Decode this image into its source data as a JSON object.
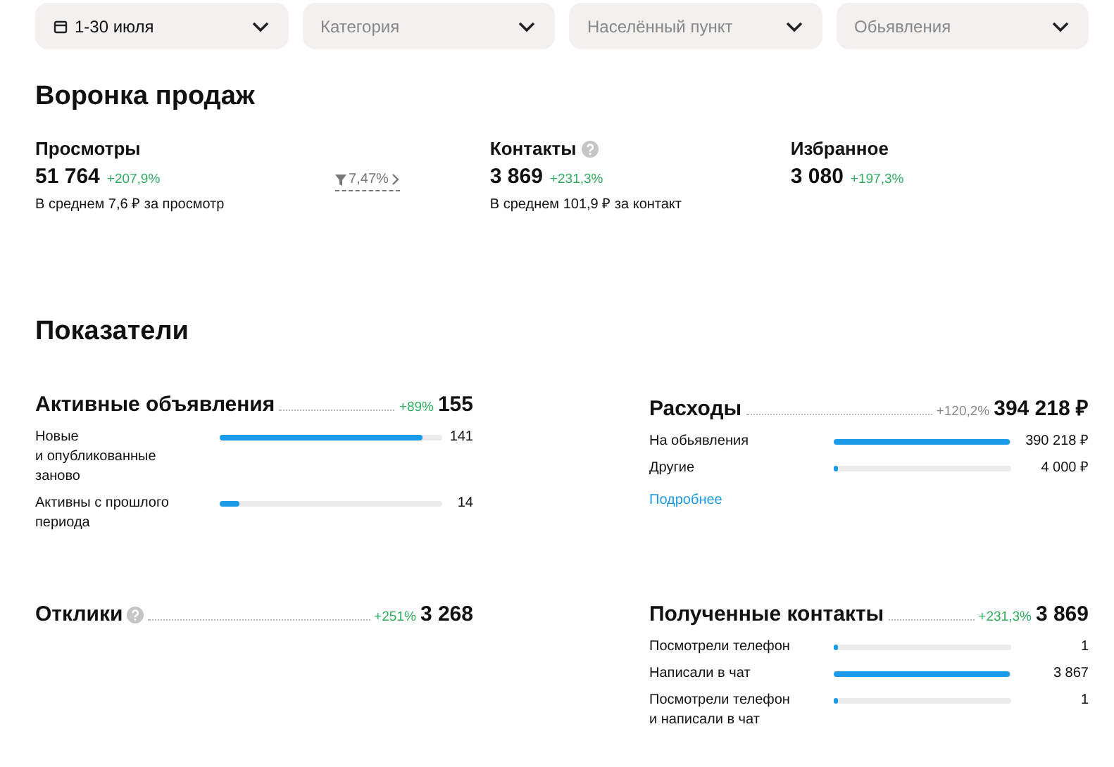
{
  "filters": [
    {
      "kind": "date",
      "label": "1-30 июля",
      "placeholder": false
    },
    {
      "kind": "select",
      "label": "Категория",
      "placeholder": true
    },
    {
      "kind": "select",
      "label": "Населённый пункт",
      "placeholder": true
    },
    {
      "kind": "select",
      "label": "Обьявления",
      "placeholder": true
    }
  ],
  "funnel": {
    "title": "Воронка продаж",
    "stages": [
      {
        "title": "Просмотры",
        "value": "51 764",
        "change": "+207,9%",
        "note": "В среднем 7,6 ₽ за просмотр",
        "conversion": "7,47%"
      },
      {
        "title": "Контакты",
        "help": true,
        "value": "3 869",
        "change": "+231,3%",
        "note": "В среднем 101,9 ₽ за контакт"
      },
      {
        "title": "Избранное",
        "value": "3 080",
        "change": "+197,3%"
      }
    ]
  },
  "indicators": {
    "title": "Показатели",
    "cards": [
      {
        "title": "Активные объявления",
        "change": "+89%",
        "color": "#2fae5f",
        "total": "155",
        "rows": [
          {
            "label": "Новые\nи опубликованные\nзаново",
            "level": 0.91,
            "value": "141"
          },
          {
            "label": "Активны с прошлого\nпериода",
            "level": 0.09,
            "value": "14"
          }
        ]
      },
      {
        "title": "Расходы",
        "change": "+120,2%",
        "color": "#8a8a8a",
        "total": "394 218 ₽",
        "rows": [
          {
            "label": "На обьявления",
            "level": 0.99,
            "value": "390 218 ₽"
          },
          {
            "label": "Другие",
            "level": 0.01,
            "value": "4 000 ₽"
          }
        ],
        "link": "Подробнее"
      },
      {
        "title": "Отклики",
        "help": true,
        "change": "+251%",
        "color": "#2fae5f",
        "total": "3 268"
      },
      {
        "title": "Полученные контакты",
        "change": "+231,3%",
        "color": "#2fae5f",
        "total": "3 869",
        "rows": [
          {
            "label": "Посмотрели телефон",
            "level": 0.01,
            "value": "1"
          },
          {
            "label": "Написали в чат",
            "level": 0.99,
            "value": "3 867"
          },
          {
            "label": "Посмотрели телефон\nи написали в чат",
            "level": 0.01,
            "value": "1"
          }
        ]
      }
    ]
  }
}
